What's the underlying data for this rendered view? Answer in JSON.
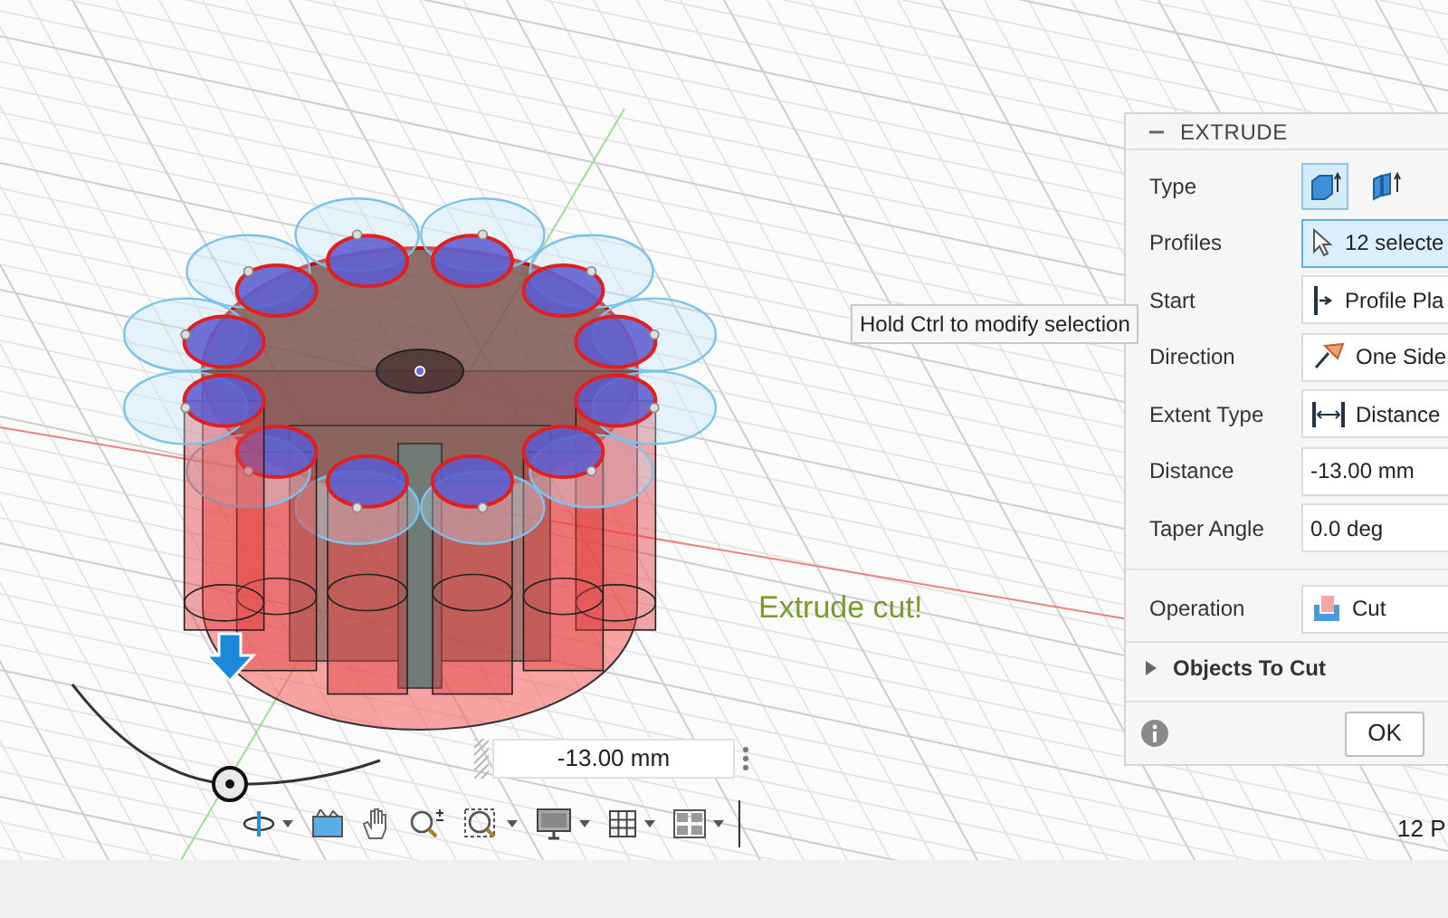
{
  "viewport": {
    "annotation": "Extrude cut!",
    "tooltip": "Hold Ctrl to modify selection",
    "status_text": "12 P",
    "dimension_input": {
      "value": "-13.00 mm"
    }
  },
  "toolbar": [
    {
      "kind": "orbit",
      "has_menu": true
    },
    {
      "kind": "look",
      "has_menu": false
    },
    {
      "kind": "pan",
      "has_menu": false
    },
    {
      "kind": "zoom",
      "has_menu": false
    },
    {
      "kind": "fit",
      "has_menu": true
    },
    {
      "kind": "display",
      "has_menu": true
    },
    {
      "kind": "grid",
      "has_menu": true
    },
    {
      "kind": "viewports",
      "has_menu": true
    }
  ],
  "panel": {
    "title": "EXTRUDE",
    "collapsed": false,
    "rows": [
      {
        "kind": "type",
        "label": "Type",
        "options": [
          {
            "selected": true
          },
          {
            "selected": false
          }
        ]
      },
      {
        "kind": "selection",
        "label": "Profiles",
        "value": "12 selecte",
        "selected": true
      },
      {
        "kind": "start",
        "label": "Start",
        "value": "Profile Pla"
      },
      {
        "kind": "direction",
        "label": "Direction",
        "value": "One Side"
      },
      {
        "kind": "extent",
        "label": "Extent Type",
        "value": "Distance"
      },
      {
        "kind": "input",
        "label": "Distance",
        "value": "-13.00 mm"
      },
      {
        "kind": "input",
        "label": "Taper Angle",
        "value": "0.0 deg"
      },
      {
        "kind": "operation",
        "label": "Operation",
        "value": "Cut",
        "divider": true
      }
    ],
    "section": {
      "label": "Objects To Cut",
      "expanded": false
    },
    "ok_button": "OK"
  }
}
